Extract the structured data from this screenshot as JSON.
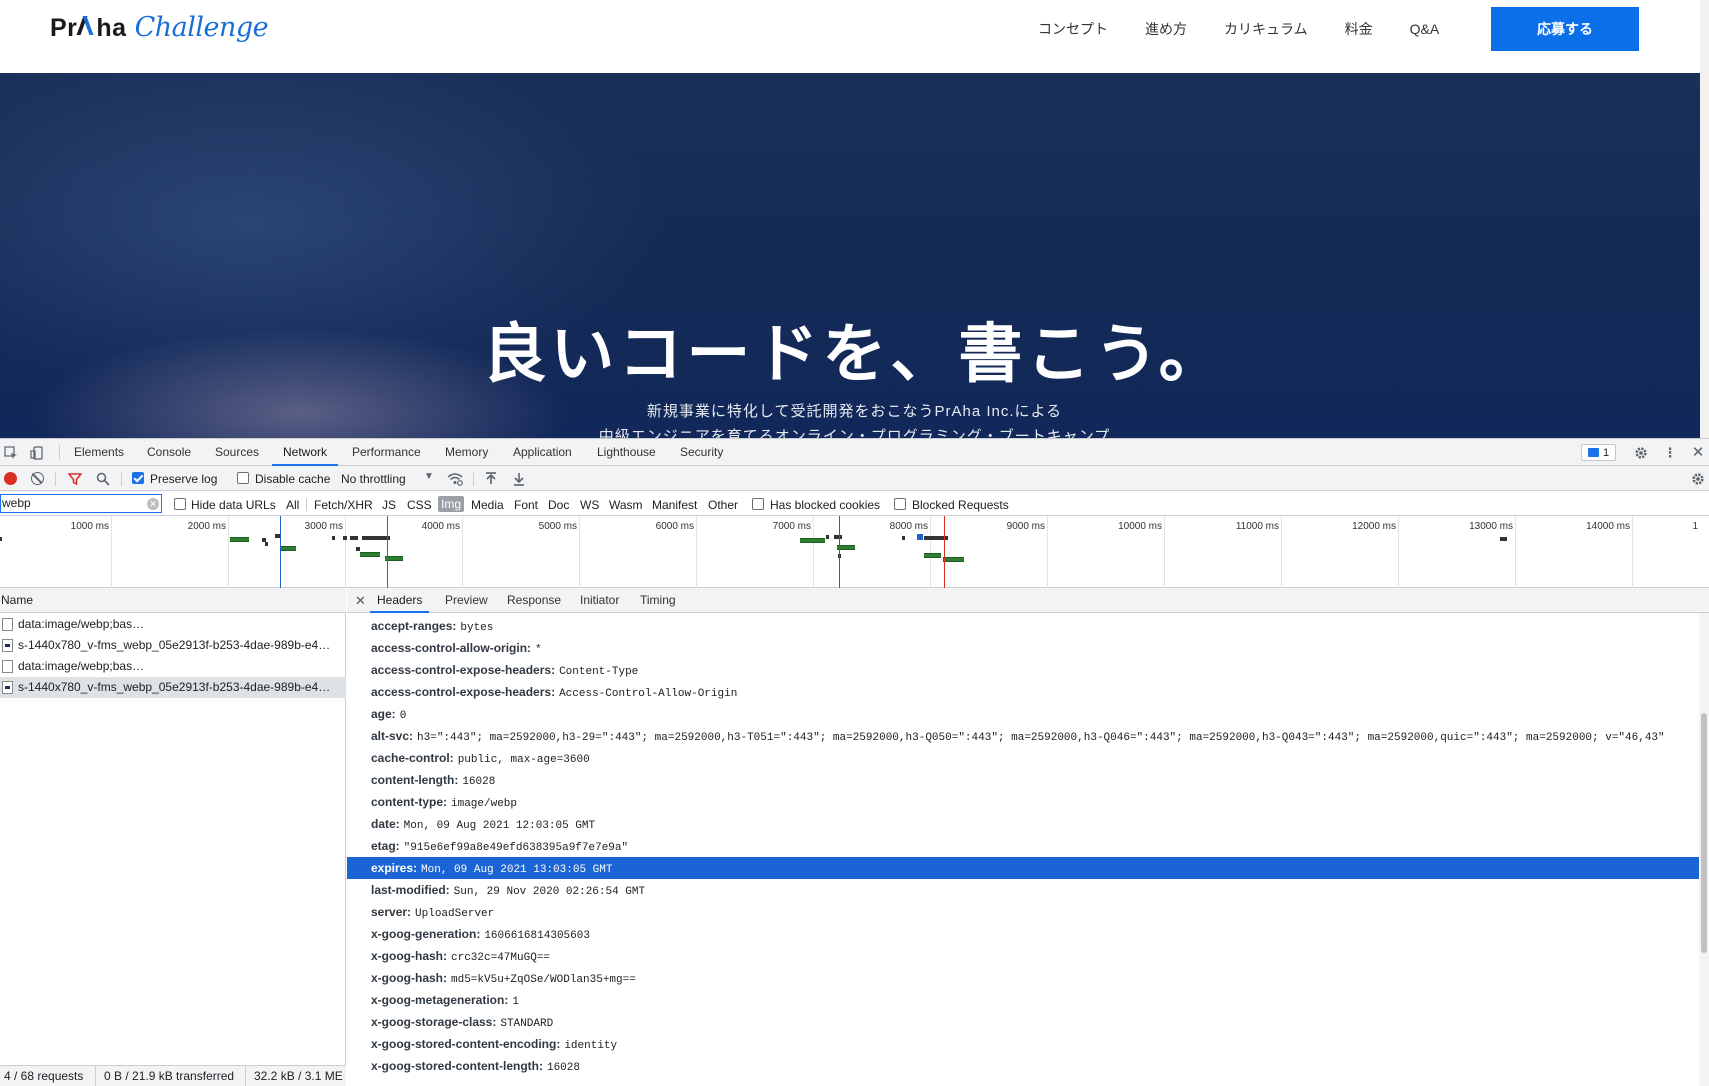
{
  "site": {
    "logo": {
      "praha_pre": "Pr",
      "praha_post": "ha",
      "challenge": "Challenge"
    },
    "nav": [
      "コンセプト",
      "進め方",
      "カリキュラム",
      "料金",
      "Q&A"
    ],
    "apply_label": "応募する",
    "hero_title": "良いコードを、書こう。",
    "hero_sub1": "新規事業に特化して受託開発をおこなうPrAha Inc.による",
    "hero_sub2": "中級エンジニアを育てるオンライン・プログラミング・ブートキャンプ"
  },
  "devtools": {
    "tabs": [
      "Elements",
      "Console",
      "Sources",
      "Network",
      "Performance",
      "Memory",
      "Application",
      "Lighthouse",
      "Security"
    ],
    "active_tab": "Network",
    "issues_count": "1",
    "toolbar": {
      "preserve_log": "Preserve log",
      "disable_cache": "Disable cache",
      "throttling": "No throttling"
    },
    "filter": {
      "value": "webp",
      "hide_data_urls": "Hide data URLs",
      "types": [
        "All",
        "Fetch/XHR",
        "JS",
        "CSS",
        "Img",
        "Media",
        "Font",
        "Doc",
        "WS",
        "Wasm",
        "Manifest",
        "Other"
      ],
      "active_type": "Img",
      "has_blocked_cookies": "Has blocked cookies",
      "blocked_requests": "Blocked Requests"
    },
    "overview": {
      "ticks": [
        "1000 ms",
        "2000 ms",
        "3000 ms",
        "4000 ms",
        "5000 ms",
        "6000 ms",
        "7000 ms",
        "8000 ms",
        "9000 ms",
        "10000 ms",
        "11000 ms",
        "12000 ms",
        "13000 ms",
        "14000 ms",
        "1"
      ]
    },
    "requests": {
      "name_header": "Name",
      "rows": [
        "data:image/webp;bas…",
        "s-1440x780_v-fms_webp_05e2913f-b253-4dae-989b-e4…",
        "data:image/webp;bas…",
        "s-1440x780_v-fms_webp_05e2913f-b253-4dae-989b-e4…"
      ],
      "status": {
        "requests": "4 / 68 requests",
        "transferred": "0 B / 21.9 kB transferred",
        "resources": "32.2 kB / 3.1 ME"
      }
    },
    "detail_tabs": [
      "Headers",
      "Preview",
      "Response",
      "Initiator",
      "Timing"
    ],
    "active_detail_tab": "Headers",
    "headers": [
      {
        "k": "accept-ranges:",
        "v": "bytes"
      },
      {
        "k": "access-control-allow-origin:",
        "v": "*"
      },
      {
        "k": "access-control-expose-headers:",
        "v": "Content-Type"
      },
      {
        "k": "access-control-expose-headers:",
        "v": "Access-Control-Allow-Origin"
      },
      {
        "k": "age:",
        "v": "0"
      },
      {
        "k": "alt-svc:",
        "v": "h3=\":443\"; ma=2592000,h3-29=\":443\"; ma=2592000,h3-T051=\":443\"; ma=2592000,h3-Q050=\":443\"; ma=2592000,h3-Q046=\":443\"; ma=2592000,h3-Q043=\":443\"; ma=2592000,quic=\":443\"; ma=2592000; v=\"46,43\""
      },
      {
        "k": "cache-control:",
        "v": "public, max-age=3600"
      },
      {
        "k": "content-length:",
        "v": "16028"
      },
      {
        "k": "content-type:",
        "v": "image/webp"
      },
      {
        "k": "date:",
        "v": "Mon, 09 Aug 2021 12:03:05 GMT"
      },
      {
        "k": "etag:",
        "v": "\"915e6ef99a8e49efd638395a9f7e7e9a\""
      },
      {
        "k": "expires:",
        "v": "Mon, 09 Aug 2021 13:03:05 GMT"
      },
      {
        "k": "last-modified:",
        "v": "Sun, 29 Nov 2020 02:26:54 GMT"
      },
      {
        "k": "server:",
        "v": "UploadServer"
      },
      {
        "k": "x-goog-generation:",
        "v": "1606616814305603"
      },
      {
        "k": "x-goog-hash:",
        "v": "crc32c=47MuGQ=="
      },
      {
        "k": "x-goog-hash:",
        "v": "md5=kV5u+ZqOSe/WODlan35+mg=="
      },
      {
        "k": "x-goog-metageneration:",
        "v": "1"
      },
      {
        "k": "x-goog-storage-class:",
        "v": "STANDARD"
      },
      {
        "k": "x-goog-stored-content-encoding:",
        "v": "identity"
      },
      {
        "k": "x-goog-stored-content-length:",
        "v": "16028"
      }
    ],
    "selected_header_index": 11,
    "colors": {
      "accent": "#1a73e8",
      "selected_row": "#1a64d6",
      "record": "#d93025",
      "filter_icon": "#d93025"
    }
  }
}
